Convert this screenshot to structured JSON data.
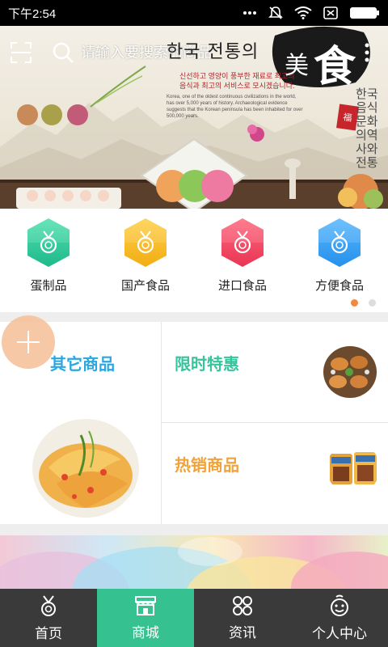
{
  "status_bar": {
    "time": "下午2:54",
    "icons": [
      "more-dots-icon",
      "notification-off-icon",
      "wifi-icon",
      "sim-icon",
      "battery-icon"
    ]
  },
  "banner": {
    "search_placeholder": "请输入要搜索的商品",
    "korean_title": "한국 전통의",
    "korean_sub_1": "신선하고 영양이 풍부한 재료로 최고의",
    "korean_sub_2": "음식과 최고의 서비스로 모시겠습니다.",
    "english_text": "Korea, one of the oldest continuous civilizations in the world, has over 5,000 years of history. Archaeological evidence suggests that the Korean peninsula has been inhabited for over 500,000 years.",
    "logo_char_1": "美",
    "logo_char_2": "食",
    "seal_text": "福",
    "vertical_text": "한국음식문화의역사와전통"
  },
  "categories": [
    {
      "label": "蛋制品",
      "icon": "medal-icon",
      "color_top": "#52e0b0",
      "color_bottom": "#1fb98a"
    },
    {
      "label": "国产食品",
      "icon": "medal-icon",
      "color_top": "#ffd04a",
      "color_bottom": "#f2ad14"
    },
    {
      "label": "进口食品",
      "icon": "medal-icon",
      "color_top": "#ff6a7f",
      "color_bottom": "#e83555"
    },
    {
      "label": "方便食品",
      "icon": "medal-icon",
      "color_top": "#5ab8ff",
      "color_bottom": "#2690ea"
    }
  ],
  "pager": {
    "active_color": "#f08a3c",
    "inactive_color": "#dddddd"
  },
  "promo": {
    "other": "其它商品",
    "limited": "限时特惠",
    "hot": "热销商品"
  },
  "tabbar": {
    "items": [
      {
        "label": "首页",
        "icon": "medal-icon",
        "active": false
      },
      {
        "label": "商城",
        "icon": "store-icon",
        "active": true
      },
      {
        "label": "资讯",
        "icon": "grid-icon",
        "active": false
      },
      {
        "label": "个人中心",
        "icon": "user-face-icon",
        "active": false
      }
    ],
    "active_color": "#36c190",
    "bg_color": "#3a3a3a"
  }
}
